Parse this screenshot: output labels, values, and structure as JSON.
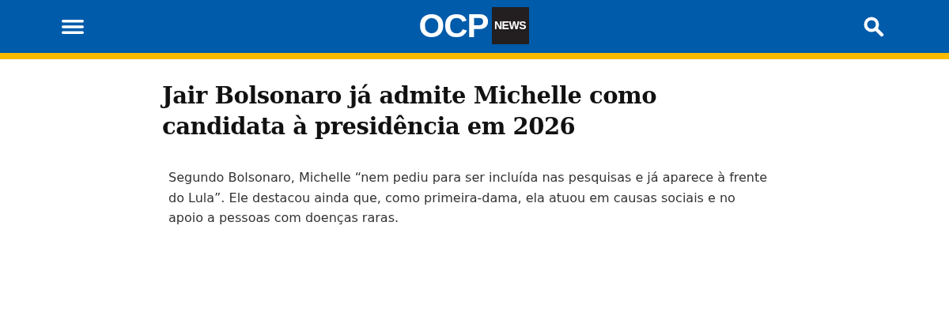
{
  "header": {
    "logo": {
      "main": "OCP",
      "badge": "NEWS"
    }
  },
  "article": {
    "title": "Jair Bolsonaro já admite Michelle como candidata à presidência em 2026",
    "lead": "Segundo Bolsonaro, Michelle “nem pediu para ser incluída nas pesquisas e já aparece à frente do Lula”. Ele destacou ainda que, como primeira-dama, ela atuou em causas sociais e no apoio a pessoas com doenças raras."
  }
}
